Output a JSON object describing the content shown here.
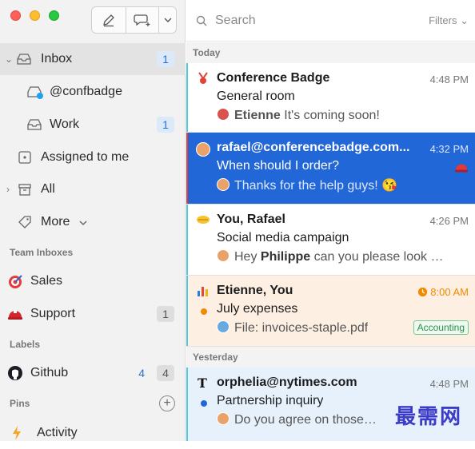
{
  "sidebar": {
    "items": [
      {
        "label": "Inbox",
        "badge": "1"
      },
      {
        "label": "@confbadge"
      },
      {
        "label": "Work",
        "badge": "1"
      },
      {
        "label": "Assigned to me"
      },
      {
        "label": "All"
      },
      {
        "label": "More"
      }
    ],
    "team_inboxes_title": "Team Inboxes",
    "team_inboxes": [
      {
        "label": "Sales"
      },
      {
        "label": "Support",
        "badge": "1"
      }
    ],
    "labels_title": "Labels",
    "labels": [
      {
        "label": "Github",
        "badge_unread": "4",
        "badge_total": "4"
      }
    ],
    "pins_title": "Pins",
    "pins": [
      {
        "label": "Activity"
      }
    ]
  },
  "search": {
    "placeholder": "Search",
    "filters_label": "Filters"
  },
  "groups": {
    "today": "Today",
    "yesterday": "Yesterday"
  },
  "conversations": [
    {
      "from": "Conference Badge",
      "subject": "General room",
      "preview_author": "Etienne",
      "preview": "It's coming soon!",
      "time": "4:48 PM"
    },
    {
      "from": "rafael@conferencebadge.com...",
      "subject": "When should I order?",
      "preview": "Thanks for the help guys! 😘",
      "time": "4:32 PM"
    },
    {
      "from": "You, Rafael",
      "subject": "Social media campaign",
      "preview_prefix": "Hey",
      "preview_author": "Philippe",
      "preview": "can you please look int...",
      "time": "4:26 PM"
    },
    {
      "from": "Etienne, You",
      "subject": "July expenses",
      "preview": "File: invoices-staple.pdf",
      "time": "8:00 AM",
      "tag": "Accounting"
    },
    {
      "from": "orphelia@nytimes.com",
      "subject": "Partnership inquiry",
      "preview": "Do you agree on those te",
      "time": "4:48 PM"
    }
  ],
  "watermark": "最需网",
  "colors": {
    "accent": "#2267d8",
    "selected_bar": "#e23a3a",
    "unread_bar": "#4fc8e0",
    "tag_green": "#2f8f4e"
  }
}
